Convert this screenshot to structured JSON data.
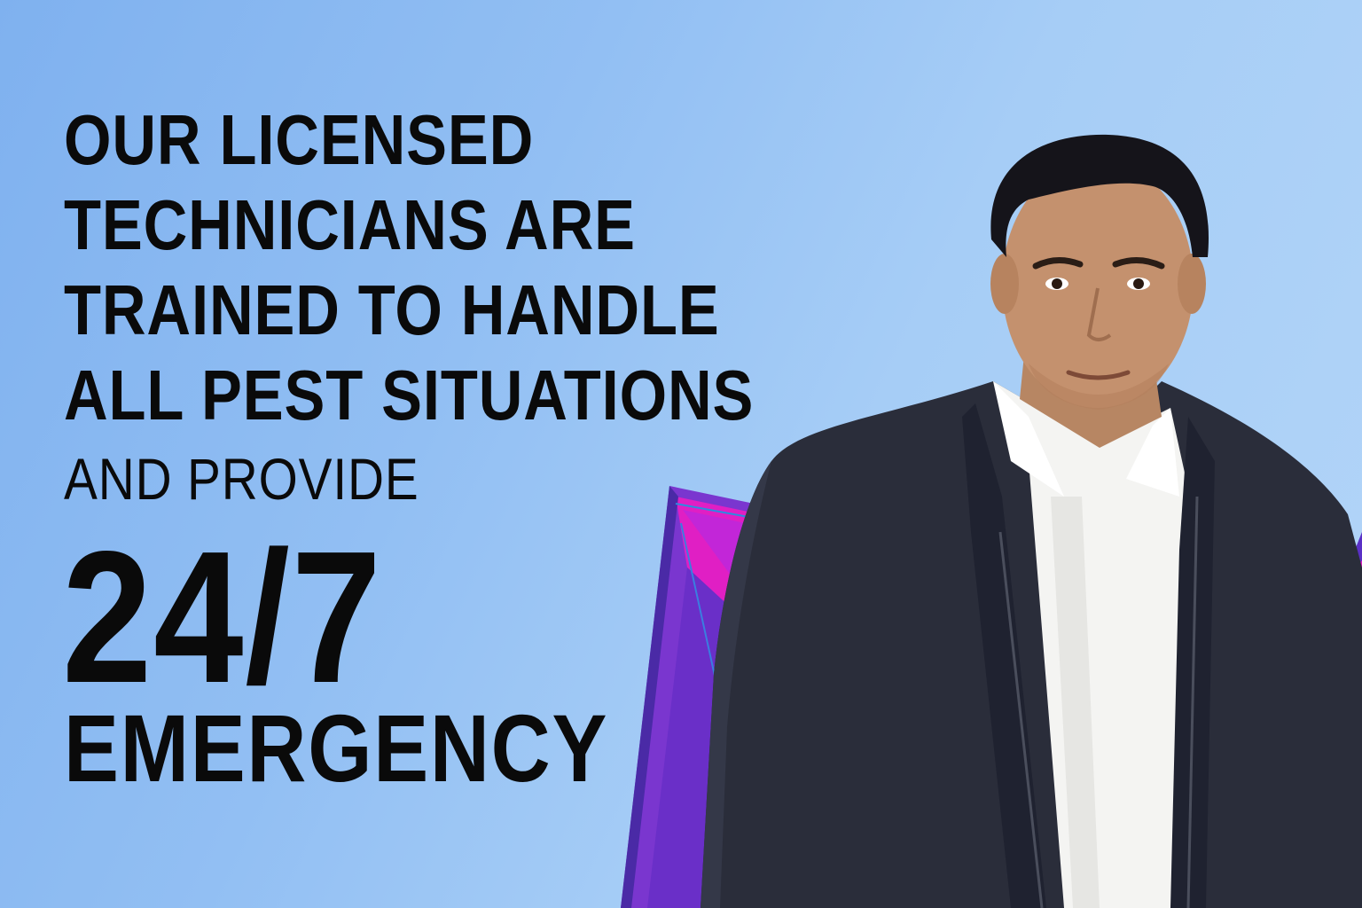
{
  "headline": {
    "lines": [
      "OUR LICENSED",
      "TECHNICIANS ARE",
      "TRAINED TO HANDLE",
      "ALL PEST SITUATIONS"
    ],
    "subline": "AND PROVIDE",
    "highlight": "24/7",
    "highlight_word": "EMERGENCY"
  },
  "colors": {
    "background_start": "#7fb1ef",
    "background_end": "#b3d5f8",
    "text": "#0a0a0a",
    "accent_magenta": "#e01fc4",
    "accent_purple": "#7b3fd6",
    "jacket": "#2a2d3a",
    "shirt": "#f4f4f2"
  },
  "image": {
    "subject": "person-portrait",
    "icon": "technician-photo"
  }
}
